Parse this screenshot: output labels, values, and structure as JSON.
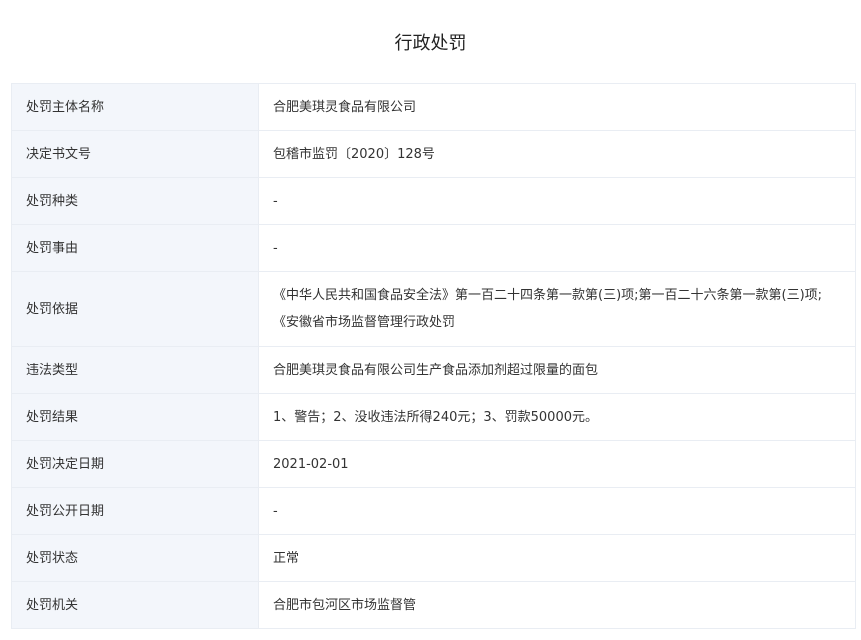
{
  "page": {
    "title": "行政处罚"
  },
  "rows": [
    {
      "label": "处罚主体名称",
      "value": "合肥美琪灵食品有限公司"
    },
    {
      "label": "决定书文号",
      "value": "包稽市监罚〔2020〕128号"
    },
    {
      "label": "处罚种类",
      "value": "-"
    },
    {
      "label": "处罚事由",
      "value": "-"
    },
    {
      "label": "处罚依据",
      "value": "《中华人民共和国食品安全法》第一百二十四条第一款第(三)项;第一百二十六条第一款第(三)项;《安徽省市场监督管理行政处罚"
    },
    {
      "label": "违法类型",
      "value": "合肥美琪灵食品有限公司生产食品添加剂超过限量的面包"
    },
    {
      "label": "处罚结果",
      "value": "1、警告；2、没收违法所得240元；3、罚款50000元。"
    },
    {
      "label": "处罚决定日期",
      "value": "2021-02-01"
    },
    {
      "label": "处罚公开日期",
      "value": "-"
    },
    {
      "label": "处罚状态",
      "value": "正常"
    },
    {
      "label": "处罚机关",
      "value": "合肥市包河区市场监督管"
    }
  ]
}
